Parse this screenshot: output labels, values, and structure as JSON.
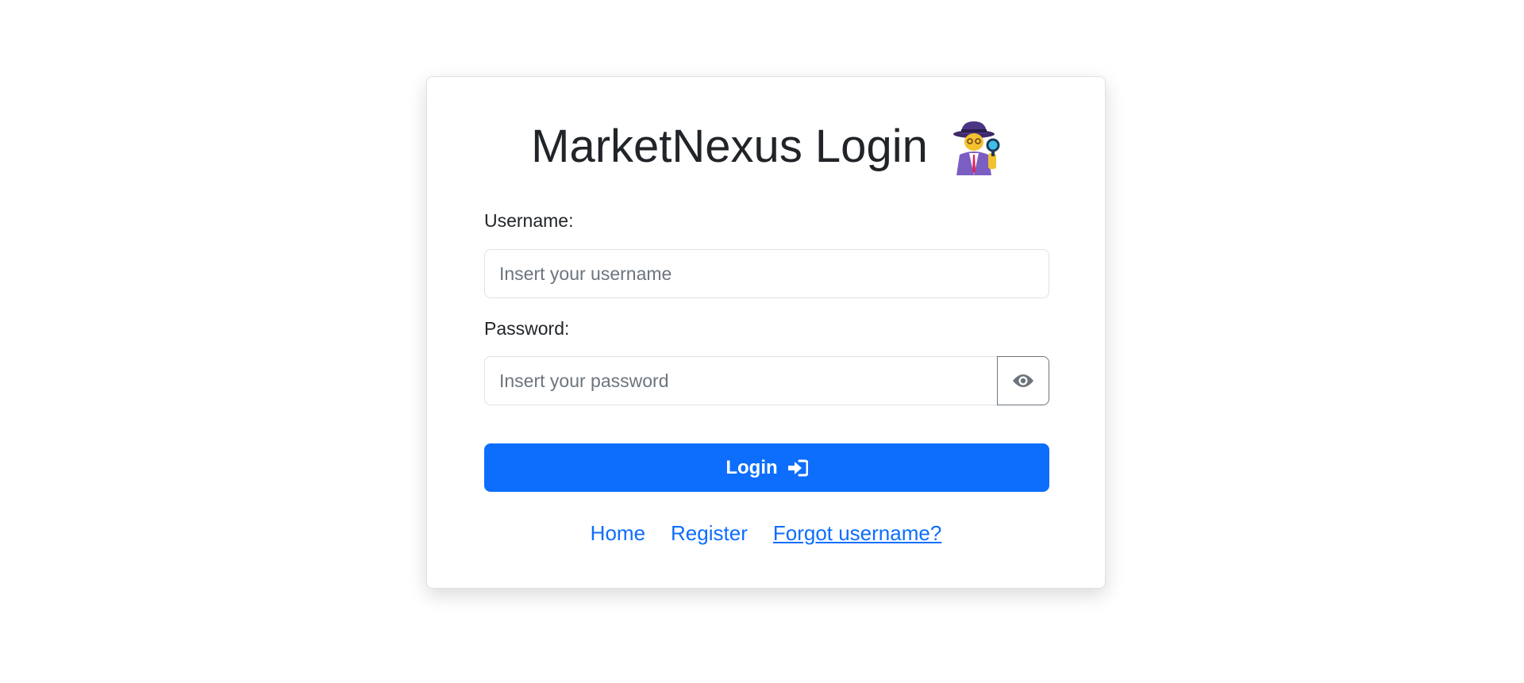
{
  "login_card": {
    "title": "MarketNexus Login",
    "title_icon": "detective-icon",
    "username": {
      "label": "Username:",
      "placeholder": "Insert your username",
      "value": ""
    },
    "password": {
      "label": "Password:",
      "placeholder": "Insert your password",
      "value": "",
      "toggle_icon": "eye-icon"
    },
    "login_button": {
      "label": "Login",
      "icon": "sign-in-icon"
    },
    "links": [
      {
        "label": "Home"
      },
      {
        "label": "Register"
      },
      {
        "label": "Forgot username?"
      }
    ]
  },
  "colors": {
    "primary": "#0d6efd",
    "text": "#212529",
    "muted": "#6c757d",
    "border": "#dee2e6"
  }
}
